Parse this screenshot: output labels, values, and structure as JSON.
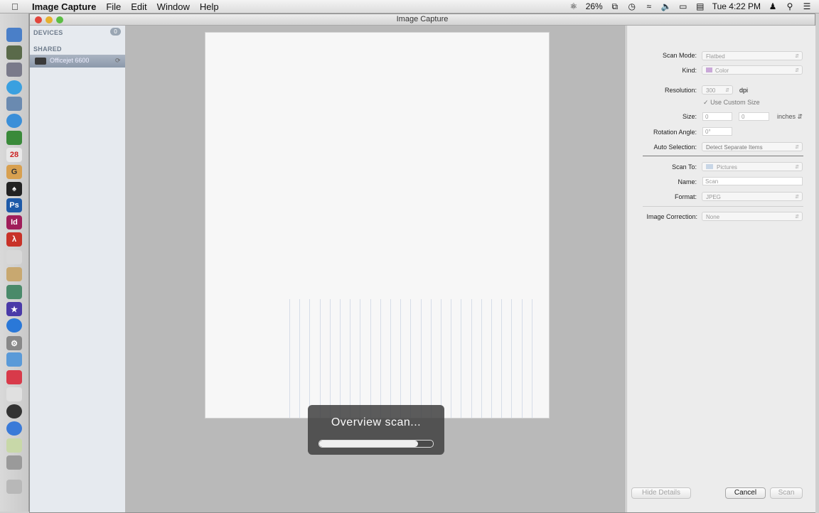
{
  "menubar": {
    "app_name": "Image Capture",
    "items": [
      "File",
      "Edit",
      "Window",
      "Help"
    ],
    "battery": "26%",
    "clock": "Tue 4:22 PM"
  },
  "window": {
    "title": "Image Capture"
  },
  "sidebar": {
    "devices_header": "DEVICES",
    "devices_count": "0",
    "shared_header": "SHARED",
    "shared_device": "Officejet 6600"
  },
  "scan": {
    "overlay_message": "Overview scan...",
    "progress": 0.87
  },
  "details": {
    "scan_mode_label": "Scan Mode:",
    "scan_mode_value": "Flatbed",
    "kind_label": "Kind:",
    "kind_value": "Color",
    "resolution_label": "Resolution:",
    "resolution_value": "300",
    "resolution_unit": "dpi",
    "custom_size_label": "Use Custom Size",
    "size_label": "Size:",
    "size_width": "0",
    "size_height": "0",
    "size_unit": "inches",
    "rotation_label": "Rotation Angle:",
    "rotation_value": "0°",
    "auto_selection_label": "Auto Selection:",
    "auto_selection_value": "Detect Separate Items",
    "scan_to_label": "Scan To:",
    "scan_to_value": "Pictures",
    "name_label": "Name:",
    "name_value": "Scan",
    "format_label": "Format:",
    "format_value": "JPEG",
    "image_correction_label": "Image Correction:",
    "image_correction_value": "None"
  },
  "buttons": {
    "hide_details": "Hide Details",
    "cancel": "Cancel",
    "scan": "Scan"
  }
}
